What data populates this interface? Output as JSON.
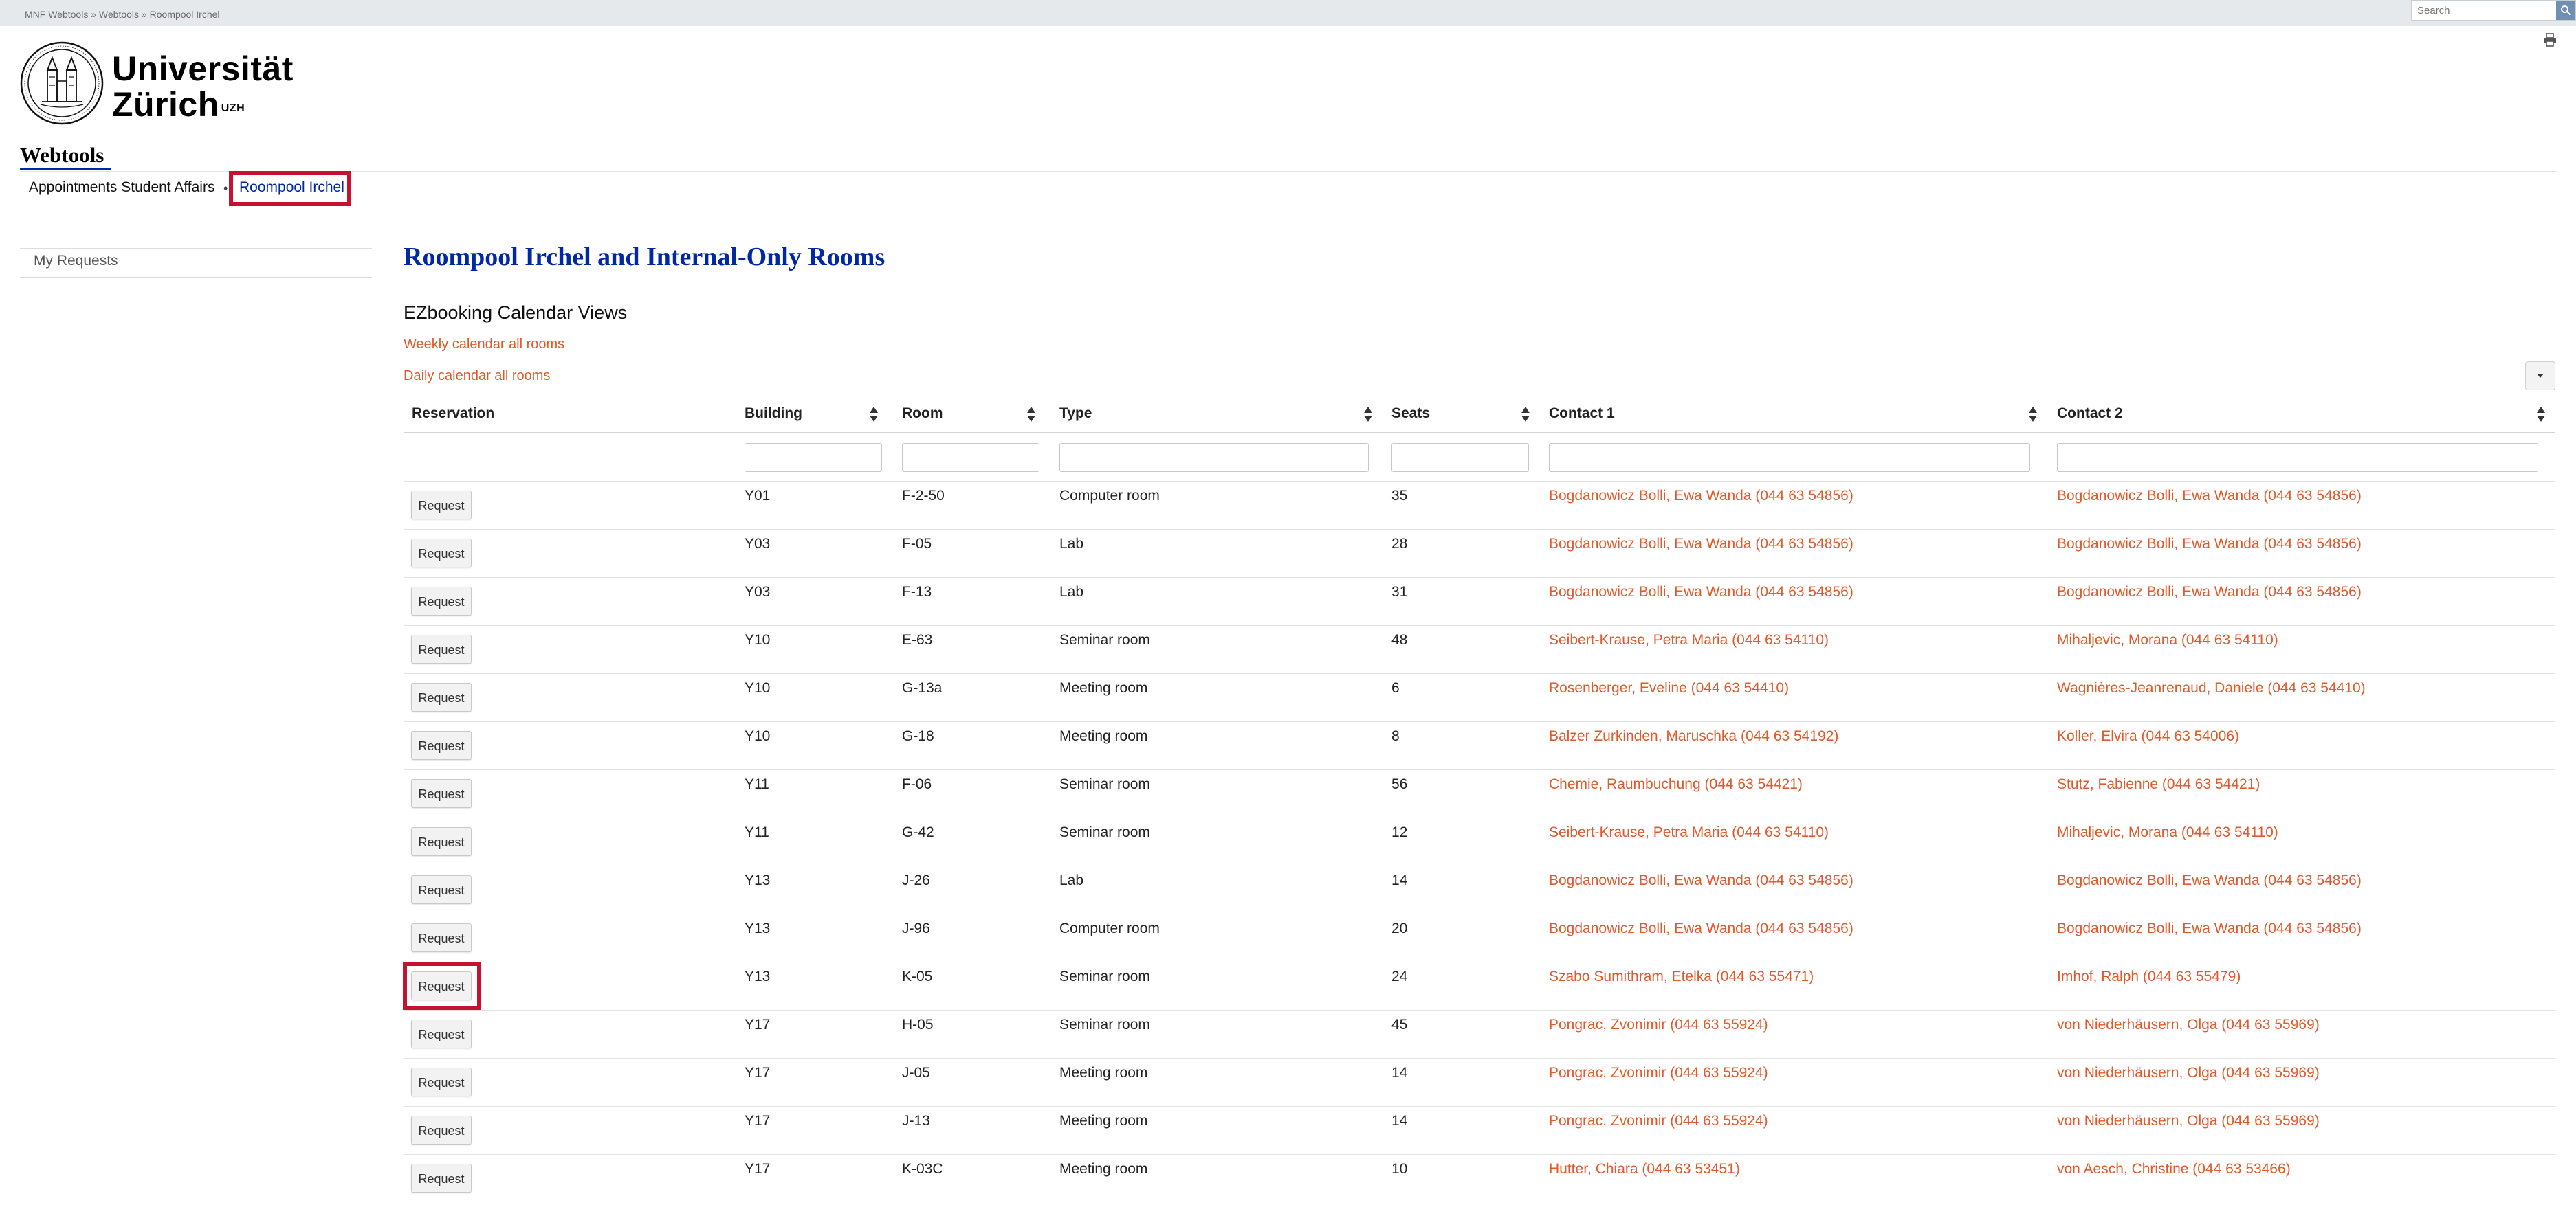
{
  "topbar": {
    "breadcrumbs": [
      "MNF Webtools",
      "Webtools",
      "Roompool Irchel"
    ],
    "breadcrumb_separator": "»",
    "search_placeholder": "Search",
    "search_icon": "search-icon"
  },
  "logo": {
    "line1": "Universität",
    "line2": "Zürich",
    "suffix": "UZH"
  },
  "site_title": "Webtools",
  "nav": {
    "items": [
      "Appointments Student Affairs",
      "Roompool Irchel"
    ],
    "separator": "•",
    "active_index": 1
  },
  "sidebar": {
    "items": [
      "My Requests"
    ]
  },
  "main": {
    "title": "Roompool Irchel and Internal-Only Rooms",
    "section_title": "EZbooking Calendar Views",
    "links": [
      "Weekly calendar all rooms",
      "Daily calendar all rooms"
    ]
  },
  "table": {
    "columns": [
      "Reservation",
      "Building",
      "Room",
      "Type",
      "Seats",
      "Contact 1",
      "Contact 2"
    ],
    "button_label": "Request",
    "rows": [
      {
        "building": "Y01",
        "room": "F-2-50",
        "type": "Computer room",
        "seats": "35",
        "contact1": "Bogdanowicz Bolli, Ewa Wanda (044 63 54856)",
        "contact2": "Bogdanowicz Bolli, Ewa Wanda (044 63 54856)"
      },
      {
        "building": "Y03",
        "room": "F-05",
        "type": "Lab",
        "seats": "28",
        "contact1": "Bogdanowicz Bolli, Ewa Wanda (044 63 54856)",
        "contact2": "Bogdanowicz Bolli, Ewa Wanda (044 63 54856)"
      },
      {
        "building": "Y03",
        "room": "F-13",
        "type": "Lab",
        "seats": "31",
        "contact1": "Bogdanowicz Bolli, Ewa Wanda (044 63 54856)",
        "contact2": "Bogdanowicz Bolli, Ewa Wanda (044 63 54856)"
      },
      {
        "building": "Y10",
        "room": "E-63",
        "type": "Seminar room",
        "seats": "48",
        "contact1": "Seibert-Krause, Petra Maria (044 63 54110)",
        "contact2": "Mihaljevic, Morana (044 63 54110)"
      },
      {
        "building": "Y10",
        "room": "G-13a",
        "type": "Meeting room",
        "seats": "6",
        "contact1": "Rosenberger, Eveline (044 63 54410)",
        "contact2": "Wagnières-Jeanrenaud, Daniele (044 63 54410)"
      },
      {
        "building": "Y10",
        "room": "G-18",
        "type": "Meeting room",
        "seats": "8",
        "contact1": "Balzer Zurkinden, Maruschka (044 63 54192)",
        "contact2": "Koller, Elvira (044 63 54006)"
      },
      {
        "building": "Y11",
        "room": "F-06",
        "type": "Seminar room",
        "seats": "56",
        "contact1": "Chemie, Raumbuchung (044 63 54421)",
        "contact2": "Stutz, Fabienne (044 63 54421)"
      },
      {
        "building": "Y11",
        "room": "G-42",
        "type": "Seminar room",
        "seats": "12",
        "contact1": "Seibert-Krause, Petra Maria (044 63 54110)",
        "contact2": "Mihaljevic, Morana (044 63 54110)"
      },
      {
        "building": "Y13",
        "room": "J-26",
        "type": "Lab",
        "seats": "14",
        "contact1": "Bogdanowicz Bolli, Ewa Wanda (044 63 54856)",
        "contact2": "Bogdanowicz Bolli, Ewa Wanda (044 63 54856)"
      },
      {
        "building": "Y13",
        "room": "J-96",
        "type": "Computer room",
        "seats": "20",
        "contact1": "Bogdanowicz Bolli, Ewa Wanda (044 63 54856)",
        "contact2": "Bogdanowicz Bolli, Ewa Wanda (044 63 54856)"
      },
      {
        "building": "Y13",
        "room": "K-05",
        "type": "Seminar room",
        "seats": "24",
        "contact1": "Szabo Sumithram, Etelka (044 63 55471)",
        "contact2": "Imhof, Ralph (044 63 55479)"
      },
      {
        "building": "Y17",
        "room": "H-05",
        "type": "Seminar room",
        "seats": "45",
        "contact1": "Pongrac, Zvonimir (044 63 55924)",
        "contact2": "von Niederhäusern, Olga (044 63 55969)"
      },
      {
        "building": "Y17",
        "room": "J-05",
        "type": "Meeting room",
        "seats": "14",
        "contact1": "Pongrac, Zvonimir (044 63 55924)",
        "contact2": "von Niederhäusern, Olga (044 63 55969)"
      },
      {
        "building": "Y17",
        "room": "J-13",
        "type": "Meeting room",
        "seats": "14",
        "contact1": "Pongrac, Zvonimir (044 63 55924)",
        "contact2": "von Niederhäusern, Olga (044 63 55969)"
      },
      {
        "building": "Y17",
        "room": "K-03C",
        "type": "Meeting room",
        "seats": "10",
        "contact1": "Hutter, Chiara (044 63 53451)",
        "contact2": "von Aesch, Christine (044 63 53466)"
      }
    ],
    "highlighted_row": 10
  },
  "colors": {
    "accent_blue": "#0028a5",
    "link_orange": "#e4582a",
    "highlight_red": "#c41230",
    "topbar_gray": "#e6e9ec"
  }
}
